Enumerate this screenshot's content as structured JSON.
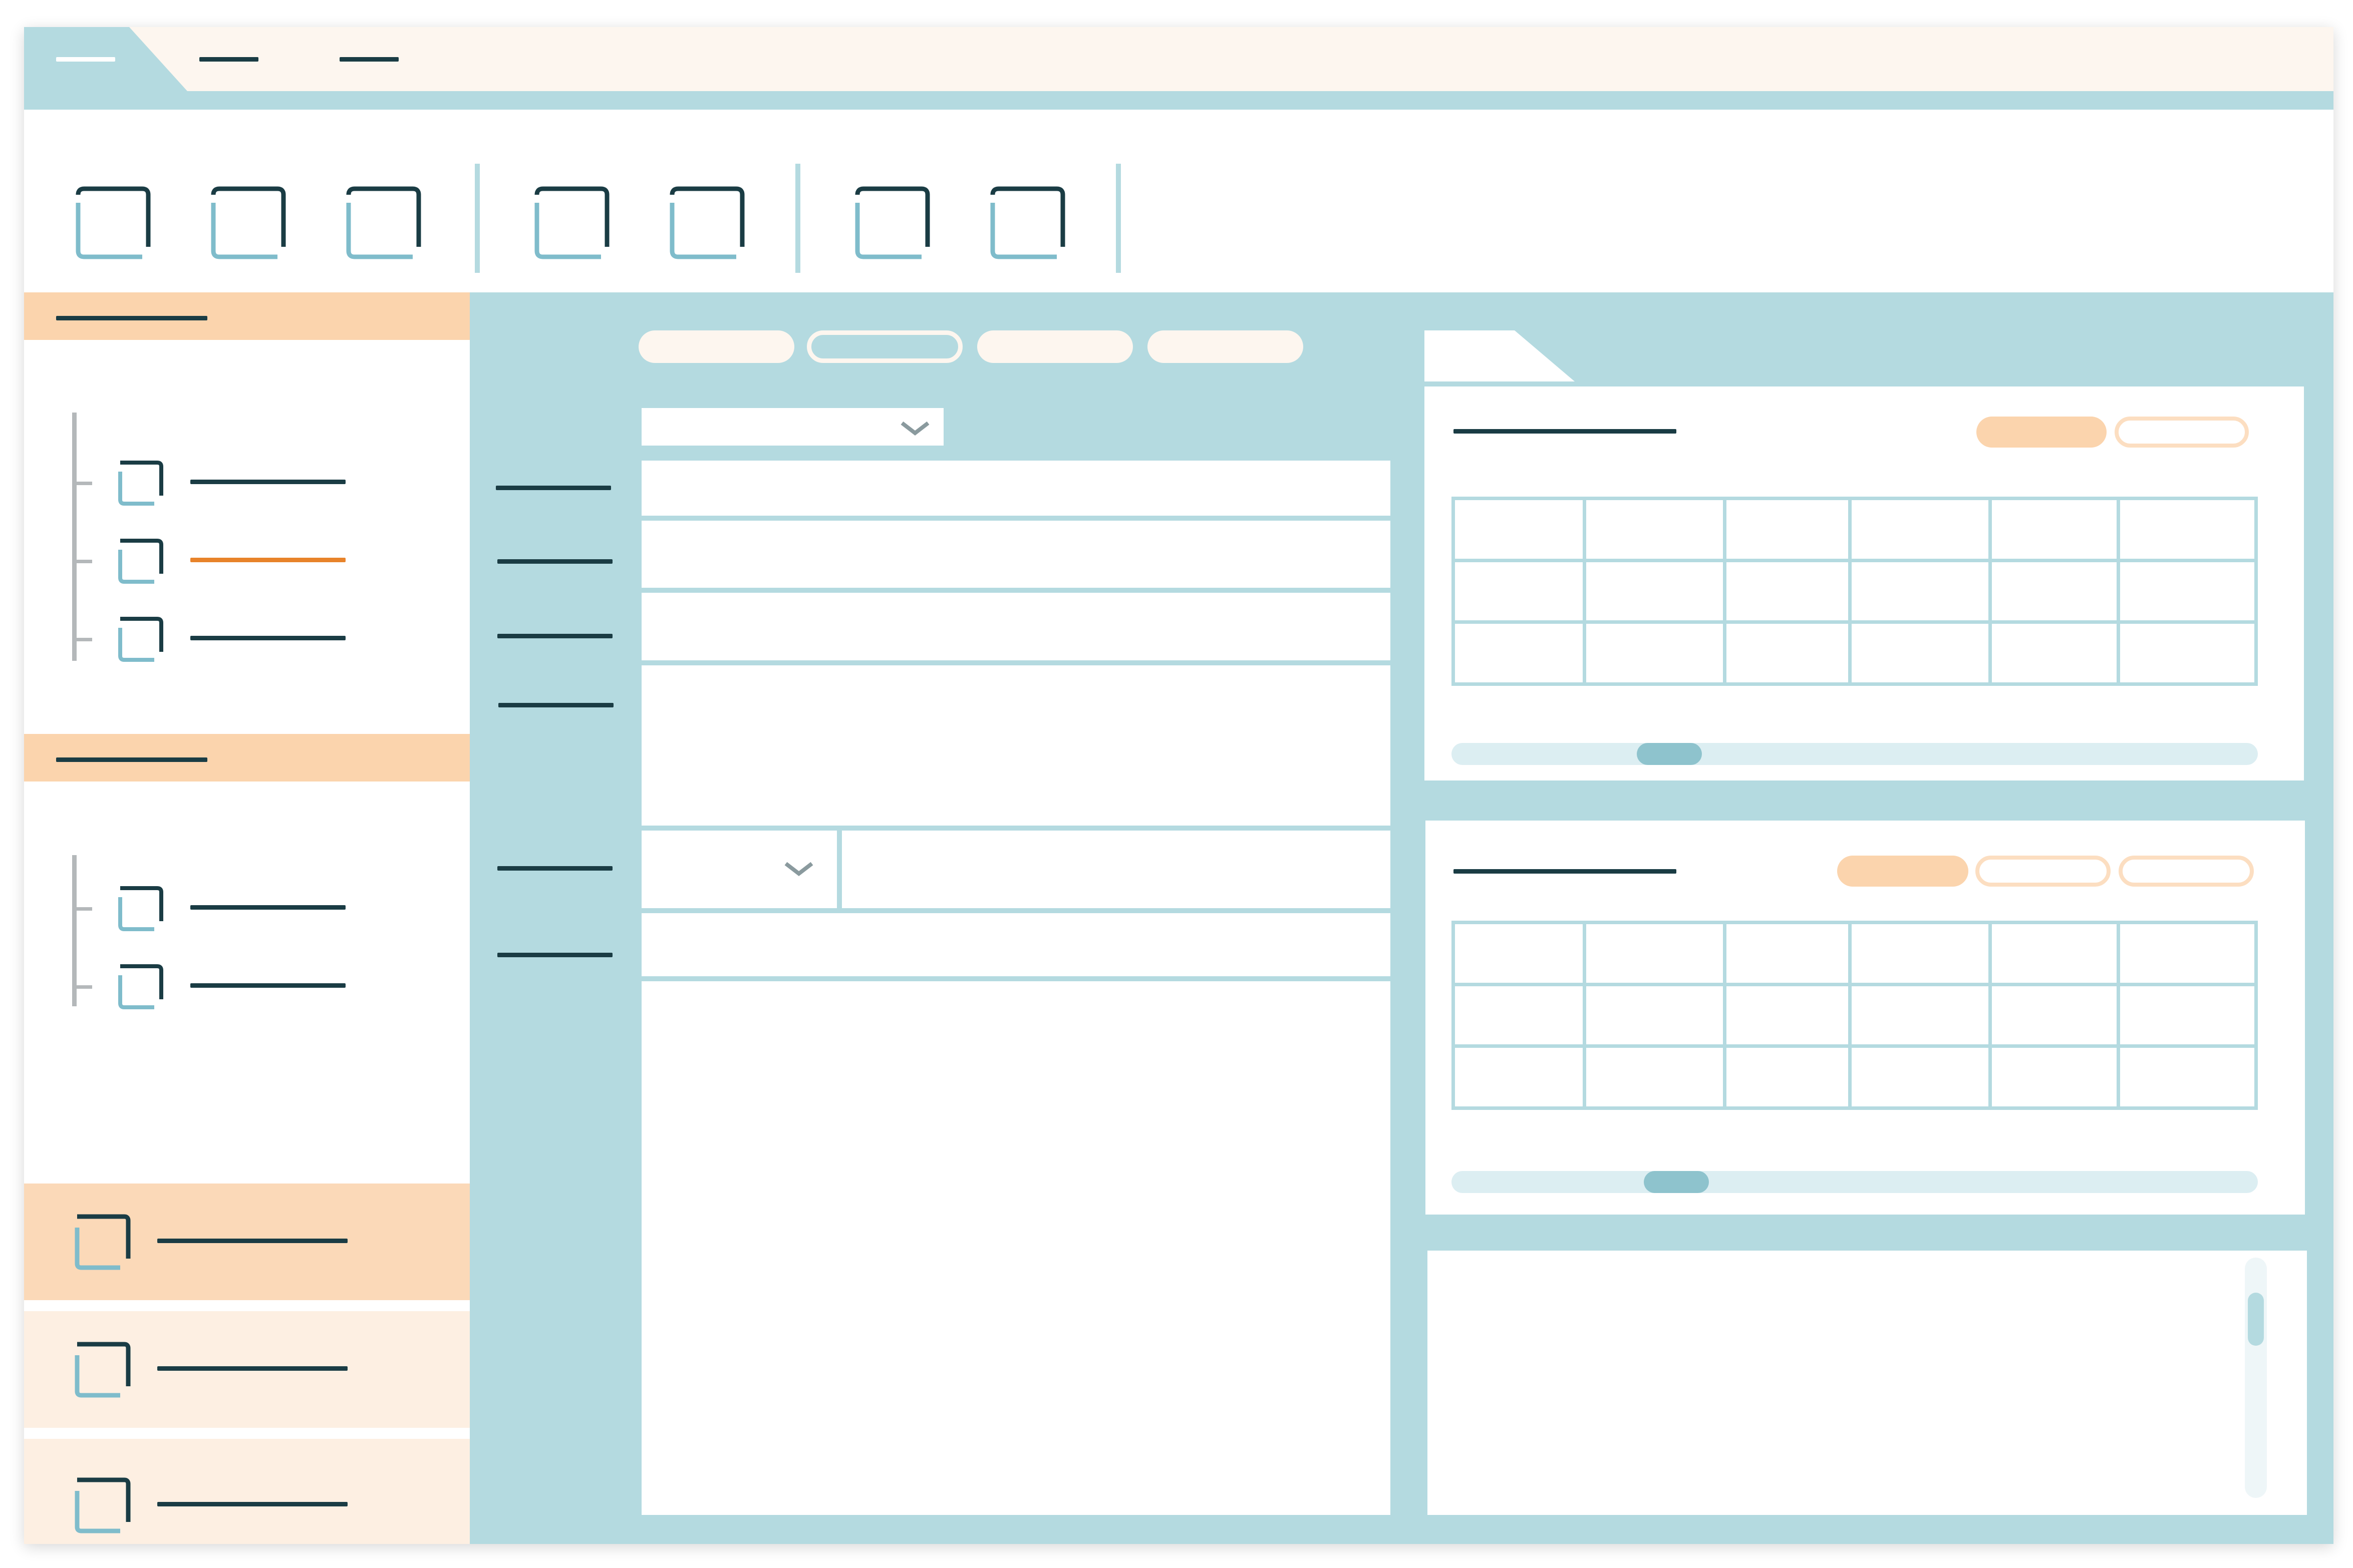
{
  "window": {
    "tabs": [
      {
        "id": "tab-1",
        "active": true
      },
      {
        "id": "tab-2",
        "active": false
      },
      {
        "id": "tab-3",
        "active": false
      }
    ]
  },
  "toolbar": {
    "groups": [
      {
        "icons": [
          "square-icon",
          "square-icon",
          "square-icon"
        ]
      },
      {
        "icons": [
          "square-icon",
          "square-icon"
        ]
      },
      {
        "icons": [
          "square-icon",
          "square-icon"
        ]
      }
    ]
  },
  "sidebar": {
    "sections": [
      {
        "header": "",
        "items": [
          {
            "label": "",
            "icon": "square-icon",
            "selected": false
          },
          {
            "label": "",
            "icon": "square-icon",
            "selected": true
          },
          {
            "label": "",
            "icon": "square-icon",
            "selected": false
          }
        ]
      },
      {
        "header": "",
        "items": [
          {
            "label": "",
            "icon": "square-icon",
            "selected": false
          },
          {
            "label": "",
            "icon": "square-icon",
            "selected": false
          }
        ]
      }
    ],
    "nav": [
      {
        "label": "",
        "icon": "square-icon",
        "active": true
      },
      {
        "label": "",
        "icon": "square-icon",
        "active": false
      },
      {
        "label": "",
        "icon": "square-icon",
        "active": false
      }
    ]
  },
  "form": {
    "tabs": [
      {
        "label": "",
        "active": false
      },
      {
        "label": "",
        "active": true
      },
      {
        "label": "",
        "active": false
      },
      {
        "label": "",
        "active": false
      }
    ],
    "top_select": {
      "value": "",
      "icon": "chevron-down-icon"
    },
    "fields": [
      {
        "label": "",
        "value": ""
      },
      {
        "label": "",
        "value": ""
      },
      {
        "label": "",
        "value": ""
      },
      {
        "label": "",
        "value": ""
      },
      {
        "label": "",
        "select_value": "",
        "value": ""
      },
      {
        "label": "",
        "value": ""
      }
    ]
  },
  "right": {
    "tab": {
      "label": ""
    },
    "panel_1": {
      "title": "",
      "buttons": [
        {
          "label": "",
          "style": "filled"
        },
        {
          "label": "",
          "style": "outline"
        }
      ],
      "table": {
        "rows": 3,
        "cols": 6,
        "cells": []
      },
      "scroll_position": 0.25
    },
    "panel_2": {
      "title": "",
      "buttons": [
        {
          "label": "",
          "style": "filled"
        },
        {
          "label": "",
          "style": "outline"
        },
        {
          "label": "",
          "style": "outline"
        }
      ],
      "table": {
        "rows": 3,
        "cols": 6,
        "cells": []
      },
      "scroll_position": 0.26
    },
    "panel_3": {
      "content": "",
      "scroll_position": 0.1
    }
  },
  "colors": {
    "frame": "#b4dae0",
    "accent_peach": "#fbd4ad",
    "cream": "#fdf6ef",
    "text_dark": "#1a3c44",
    "selected_orange": "#e8832a",
    "icon_blue": "#7fbccb",
    "scroll_thumb": "#8ec3cd"
  }
}
